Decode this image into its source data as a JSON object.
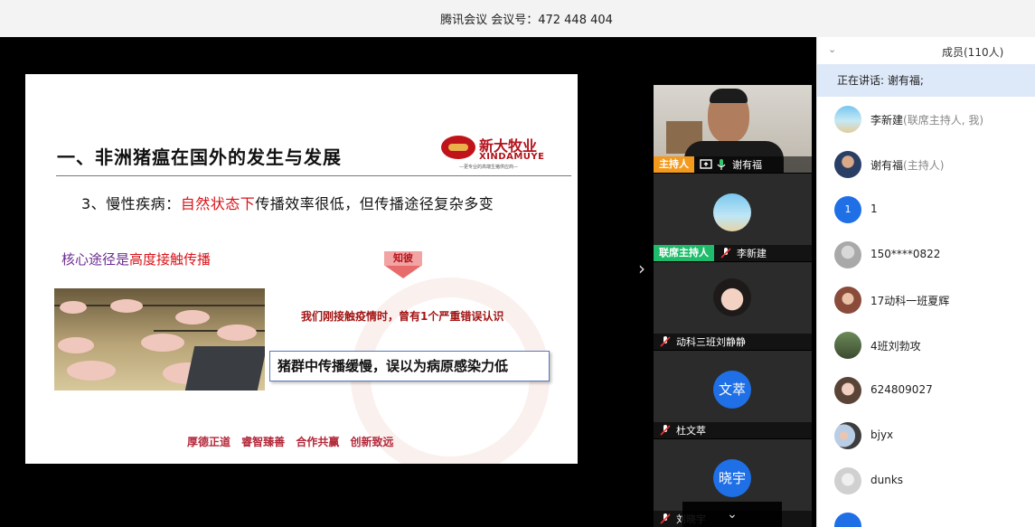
{
  "titlebar": {
    "title": "腾讯会议 会议号：472 448 404"
  },
  "slide": {
    "heading": "一、非洲猪瘟在国外的发生与发展",
    "logo_cn": "新大牧业",
    "logo_en": "XINDAMUYE",
    "logo_tag": "—更专业的高端生猪供应商—",
    "point_prefix": "3、慢性疾病：",
    "point_highlight": "自然状态下",
    "point_suffix": "传播效率很低，但传播途径复杂多变",
    "core_prefix": "核心途径是",
    "core_highlight": "高度接触传播",
    "badge": "知彼",
    "warning": "我们刚接触疫情时，曾有1个严重错误认识",
    "callout": "猪群中传播缓慢，误以为病原感染力低",
    "motto": "厚德正道 睿智臻善 合作共赢 创新致远"
  },
  "expand_arrow": "›",
  "tiles": [
    {
      "role": "主持人",
      "name": "谢有福"
    },
    {
      "role": "联席主持人",
      "name": "李新建"
    },
    {
      "name": "动科三班刘静静"
    },
    {
      "avatar_text": "文萃",
      "name": "杜文萃"
    },
    {
      "avatar_text": "晓宇",
      "name": "刘晓宇"
    }
  ],
  "scroll_down": "⌄",
  "panel": {
    "title": "成员(110人)",
    "speaking": "正在讲话: 谢有福;",
    "members": [
      {
        "name": "李新建",
        "role": "(联席主持人, 我)"
      },
      {
        "name": "谢有福",
        "role": "(主持人)"
      },
      {
        "name": "1",
        "avatar_text": "1"
      },
      {
        "name": "150****0822"
      },
      {
        "name": "17动科一班夏辉"
      },
      {
        "name": "4班刘勃攻"
      },
      {
        "name": "624809027"
      },
      {
        "name": "bjyx"
      },
      {
        "name": "dunks"
      }
    ]
  },
  "colors": {
    "host": "#f39a1e",
    "cohost": "#1fbd6b",
    "accent": "#1f6fe6",
    "speaking_bg": "#dde8f8"
  }
}
